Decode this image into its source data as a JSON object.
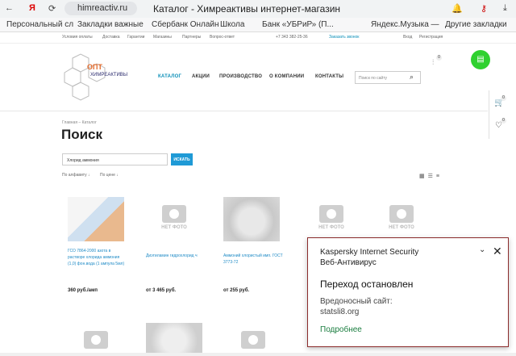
{
  "browser": {
    "url": "himreactiv.ru",
    "tab_title": "Каталог - Химреактивы интернет-магазин",
    "yandex_glyph": "Я",
    "bookmarks": [
      "Персональный сл",
      "Закладки важные",
      "Сбербанк Онлайн",
      "Школа",
      "Банк «УБРиР» (П...",
      "Яндекс.Музыка —",
      "Другие закладки"
    ]
  },
  "site": {
    "top_links": [
      "Условия оплаты",
      "Доставка",
      "Гарантии",
      "Магазины",
      "Партнеры",
      "Вопрос-ответ"
    ],
    "phone": "+7 343 382-25-36",
    "callback": "Заказать звонок",
    "login": "Вход",
    "register": "Регистрация",
    "logo_text": "ХИМРЕАКТИВЫ",
    "nav": [
      "КАТАЛОГ",
      "АКЦИИ",
      "ПРОИЗВОДСТВО",
      "О КОМПАНИИ",
      "КОНТАКТЫ"
    ],
    "search_placeholder": "Поиск по сайту",
    "compare_count": "0",
    "cart_count": "0",
    "wish_count": "0"
  },
  "page": {
    "breadcrumb": "Главная  –  Каталог",
    "title": "Поиск",
    "query": "Хлорид аммония",
    "search_button": "ИСКАТЬ",
    "sort_alpha": "По алфавиту ↓",
    "sort_price": "По цене ↓"
  },
  "products": [
    {
      "name": "ГСО 7864-2000 азота в растворе хлорида аммония (1,0) фон.вода (1 ампула 5мл)",
      "price": "360 руб./амп",
      "photo": true
    },
    {
      "name": "Диэтиламин гидрохлорид ч",
      "price": "от 3 465 руб.",
      "photo": false
    },
    {
      "name": "Аммоний хлористый имп. ГОСТ 3773-72",
      "price": "от 255 руб.",
      "photo": true
    },
    {
      "name": "",
      "price": "",
      "photo": false
    },
    {
      "name": "",
      "price": "",
      "photo": false
    }
  ],
  "no_photo_label": "НЕТ ФОТО",
  "popup": {
    "product": "Kaspersky Internet Security",
    "component": "Веб-Антивирус",
    "heading": "Переход остановлен",
    "malicious_label": "Вредоносный сайт:",
    "malicious_site": "statsli8.org",
    "more": "Подробнее"
  }
}
